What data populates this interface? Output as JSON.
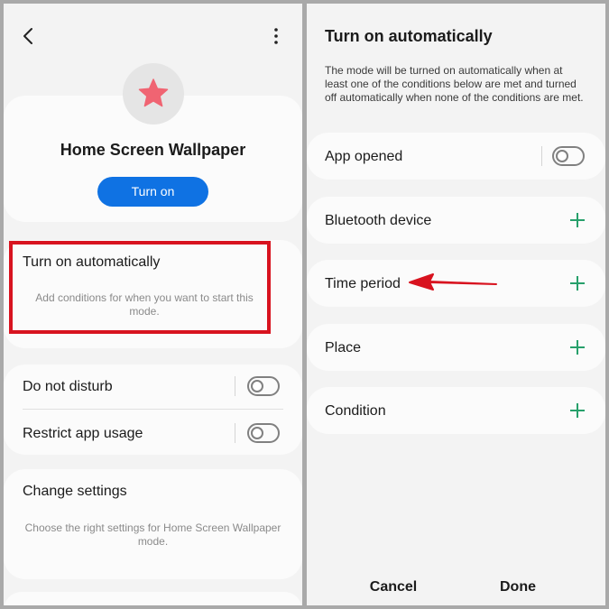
{
  "left": {
    "mode_name": "Home Screen Wallpaper",
    "turn_on_button": "Turn on",
    "auto_title": "Turn on automatically",
    "auto_subtitle": "Add conditions for when you want to start this mode.",
    "dnd_label": "Do not disturb",
    "restrict_label": "Restrict app usage",
    "change_title": "Change settings",
    "change_subtitle": "Choose the right settings for Home Screen Wallpaper mode."
  },
  "right": {
    "title": "Turn on automatically",
    "description": "The mode will be turned on automatically when at least one of the conditions below are met and turned off automatically when none of the conditions are met.",
    "app_opened": "App opened",
    "conditions": [
      "Bluetooth device",
      "Time period",
      "Place",
      "Condition"
    ],
    "cancel": "Cancel",
    "done": "Done"
  },
  "colors": {
    "accent_blue": "#0f72e3",
    "star": "#f06472",
    "plus_green": "#27a06b",
    "highlight_red": "#d8131f"
  },
  "icons": [
    "back-arrow-icon",
    "more-options-icon",
    "star-icon",
    "plus-icon",
    "red-arrow-annotation"
  ]
}
